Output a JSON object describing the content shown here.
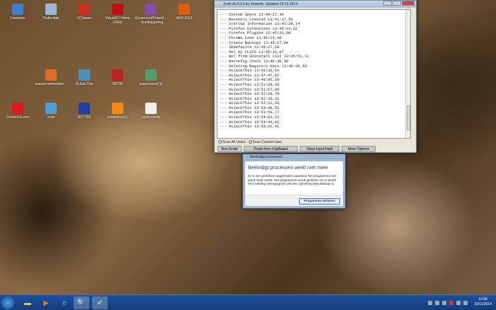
{
  "desktop_icons": [
    {
      "label": "Computer",
      "color": "#3a7fd0"
    },
    {
      "label": "Prullenbak",
      "color": "#9ab8d8"
    },
    {
      "label": "CCleaner",
      "color": "#d03020"
    },
    {
      "label": "VirtualDJ Home FREE",
      "color": "#c01010"
    },
    {
      "label": "GovernorofPoker2... - Snelkoppeling",
      "color": "#8a4ab0"
    },
    {
      "label": "AVG 2013",
      "color": "#e05a10"
    },
    {
      "label": "avastsmartinstaller...",
      "color": "#e06a20"
    },
    {
      "label": "HiJackThis",
      "color": "#4a90c0"
    },
    {
      "label": "MCPR",
      "color": "#c02020"
    },
    {
      "label": "avgremover(1)",
      "color": "#50a070"
    },
    {
      "label": "ComboFix.exe",
      "color": "#e01818"
    },
    {
      "label": "zoek",
      "color": "#50a0d0"
    },
    {
      "label": "RSTT64",
      "color": "#2040a0"
    },
    {
      "label": "avastclear(1)",
      "color": "#f08a10"
    },
    {
      "label": "pcforuminfo",
      "color": "#f0f0f0"
    }
  ],
  "zoek": {
    "title": "Zoek v5.0.0.0 by Smeenk. Updated 23-11-2014",
    "log": [
      "--- System Specs 13:40:27,40",
      "--- Recently Created 13:41:37,56",
      "--- StartUp Information 13:43:28,14",
      "--- Firefox Extensions 13:45:33,62",
      "--- Firefox Plugins 13:45:33,80",
      "--- Chrome Look 13:45:24,48",
      "--- Create Backups 13:45:27,04",
      "--- IEdefaults 13:45:27,20",
      "--- Del by CLSID 13:45:31,07",
      "--- Del from Uninstall List 13:45:51,11",
      "--- msconfig check 13:46:36,09",
      "--- Deleting Registry Keys 13:46:36,59",
      "--- HiJackThis 13:46:36,64",
      "--- HiJackThis 13:47:47,82",
      "--- HiJackThis 13:48:06,20",
      "--- HiJackThis 13:51:28,38",
      "--- HiJackThis 13:51:57,09",
      "--- HiJackThis 13:52:20,79",
      "--- HiJackThis 13:52:35,31",
      "--- HiJackThis 13:53:22,05",
      "--- HiJackThis 13:53:46,56",
      "--- HiJackThis 13:53:58,77",
      "--- HiJackThis 13:54:02,32",
      "--- HiJackThis 13:54:44,62",
      "--- HiJackThis 13:55:21,41"
    ],
    "radio_all": "Scan All Users",
    "radio_current": "Scan Current User",
    "buttons": [
      "Run Script",
      "Paste from ClipBoard",
      "Clear Input Field",
      "More Options"
    ]
  },
  "dialog": {
    "title": "Beëindigt processen",
    "heading": "Beëindigt processen werkt niet meer",
    "message": "Er is een probleem opgetreden waardoor het programma niet goed meer werkt. Het programma wordt gesloten en er wordt een melding weergegeven als een oplossing beschikbaar is.",
    "button": "Programma afsluiten"
  },
  "taskbar": {
    "time": "13:56",
    "date": "23/11/2014"
  }
}
